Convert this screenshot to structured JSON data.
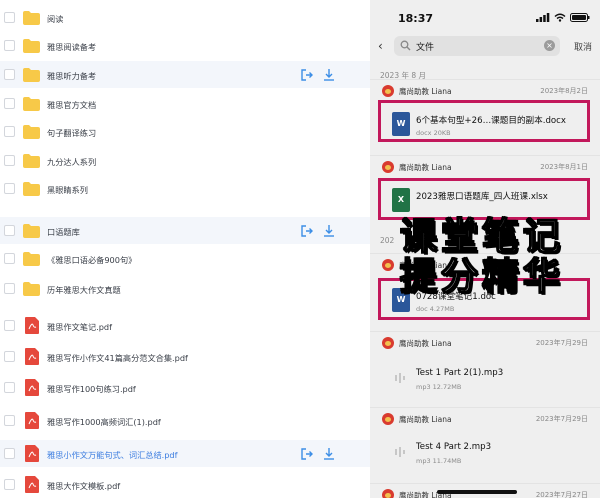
{
  "left_list": {
    "items": [
      {
        "title": "阅读",
        "type": "folder"
      },
      {
        "title": "雅思阅读备考",
        "type": "folder"
      },
      {
        "title": "雅思听力备考",
        "type": "folder",
        "highlighted": true
      },
      {
        "title": "雅思官方文档",
        "type": "folder"
      },
      {
        "title": "句子翻译练习",
        "type": "folder"
      },
      {
        "title": "九分达人系列",
        "type": "folder"
      },
      {
        "title": "黑眼睛系列",
        "type": "folder"
      },
      {
        "title": "口语题库",
        "type": "folder",
        "highlighted": true
      },
      {
        "title": "《雅思口语必备900句》",
        "type": "folder"
      },
      {
        "title": "历年雅思大作文真题",
        "type": "folder"
      },
      {
        "title": "雅思作文笔记.pdf",
        "type": "pdf"
      },
      {
        "title": "雅思写作小作文41篇高分范文合集.pdf",
        "type": "pdf"
      },
      {
        "title": "雅思写作100句练习.pdf",
        "type": "pdf"
      },
      {
        "title": "雅思写作1000高频词汇(1).pdf",
        "type": "pdf"
      },
      {
        "title": "雅思小作文万能句式、词汇总结.pdf",
        "type": "pdf",
        "highlighted": true,
        "link": true
      },
      {
        "title": "雅思大作文模板.pdf",
        "type": "pdf"
      }
    ]
  },
  "phone": {
    "status_time": "18:37",
    "search_value": "文件",
    "cancel_label": "取消",
    "section_month": "2023 年 8 月",
    "messages": [
      {
        "sender": "鹰尚助教 Liana",
        "date": "2023年8月2日",
        "file": "6个基本句型+26…课题目的副本.docx",
        "meta": "docx 20KB",
        "kind": "W",
        "color": "#2b579a"
      },
      {
        "sender": "鹰尚助教 Liana",
        "date": "2023年8月1日",
        "file": "2023雅思口语题库_四人班课.xlsx",
        "meta": "",
        "kind": "X",
        "color": "#217346"
      },
      {
        "sender": "鹰尚助教 Liana",
        "date": "",
        "file": "0728课堂笔记1.doc",
        "meta": "doc 4.27MB",
        "kind": "W",
        "color": "#2b579a"
      },
      {
        "sender": "鹰尚助教 Liana",
        "date": "2023年7月29日",
        "file": "Test 1 Part 2(1).mp3",
        "meta": "mp3 12.72MB",
        "kind": "audio",
        "color": "#ffffff"
      },
      {
        "sender": "鹰尚助教 Liana",
        "date": "2023年7月29日",
        "file": "Test 4 Part 2.mp3",
        "meta": "mp3 11.74MB",
        "kind": "audio",
        "color": "#ffffff"
      },
      {
        "sender": "鹰尚助教 Liana",
        "date": "2023年7月27日",
        "file": "",
        "meta": "",
        "kind": "none",
        "color": ""
      }
    ],
    "section_2023": "202",
    "overlay_line1": "课堂笔记",
    "overlay_line2": "提分精华"
  },
  "colors": {
    "folder": "#f7c948",
    "pdf": "#e5483c",
    "link": "#3c7de0",
    "highlight_row": "#f3f6fb",
    "red_box": "#c2185b",
    "action_icon": "#3c8ee6"
  }
}
